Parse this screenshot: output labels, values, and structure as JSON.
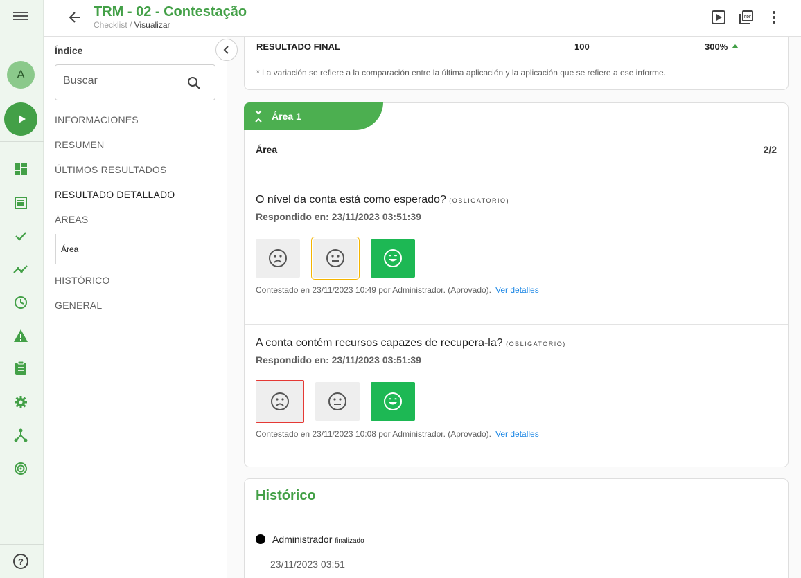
{
  "header": {
    "title": "TRM - 02 - Contestação",
    "breadcrumb_root": "Checklist",
    "breadcrumb_sep": " / ",
    "breadcrumb_current": "Visualizar"
  },
  "rail": {
    "avatar_letter": "A",
    "help": "?"
  },
  "index": {
    "title": "Índice",
    "search_placeholder": "Buscar",
    "items": [
      "INFORMACIONES",
      "RESUMEN",
      "ÚLTIMOS RESULTADOS",
      "RESULTADO DETALLADO",
      "ÁREAS"
    ],
    "sub_item": "Área",
    "items_after": [
      "HISTÓRICO",
      "GENERAL"
    ]
  },
  "resultado": {
    "label": "RESULTADO FINAL",
    "value": "100",
    "percent": "300%",
    "note": "* La variación se refiere a la comparación entre la última aplicación y la aplicación que se refiere a ese informe."
  },
  "area": {
    "tab_label": "Área 1",
    "name": "Área",
    "count": "2/2",
    "questions": [
      {
        "text": "O nível da conta está como esperado?",
        "tag": "(OBLIGATORIO)",
        "responded": "Respondido en: 23/11/2023 03:51:39",
        "selected": "neutral",
        "footer": "Contestado en 23/11/2023 10:49 por Administrador. (Aprovado).",
        "link": "Ver detalles"
      },
      {
        "text": "A conta contém recursos capazes de recupera-la?",
        "tag": "(OBLIGATORIO)",
        "responded": "Respondido en: 23/11/2023 03:51:39",
        "selected": "sad",
        "footer": "Contestado en 23/11/2023 10:08 por Administrador. (Aprovado).",
        "link": "Ver detalles"
      }
    ]
  },
  "historico": {
    "title": "Histórico",
    "user": "Administrador",
    "status": "finalizado",
    "date": "23/11/2023 03:51"
  },
  "colors": {
    "accent": "#43a047",
    "happy": "#1db854",
    "link": "#1e88e5"
  }
}
